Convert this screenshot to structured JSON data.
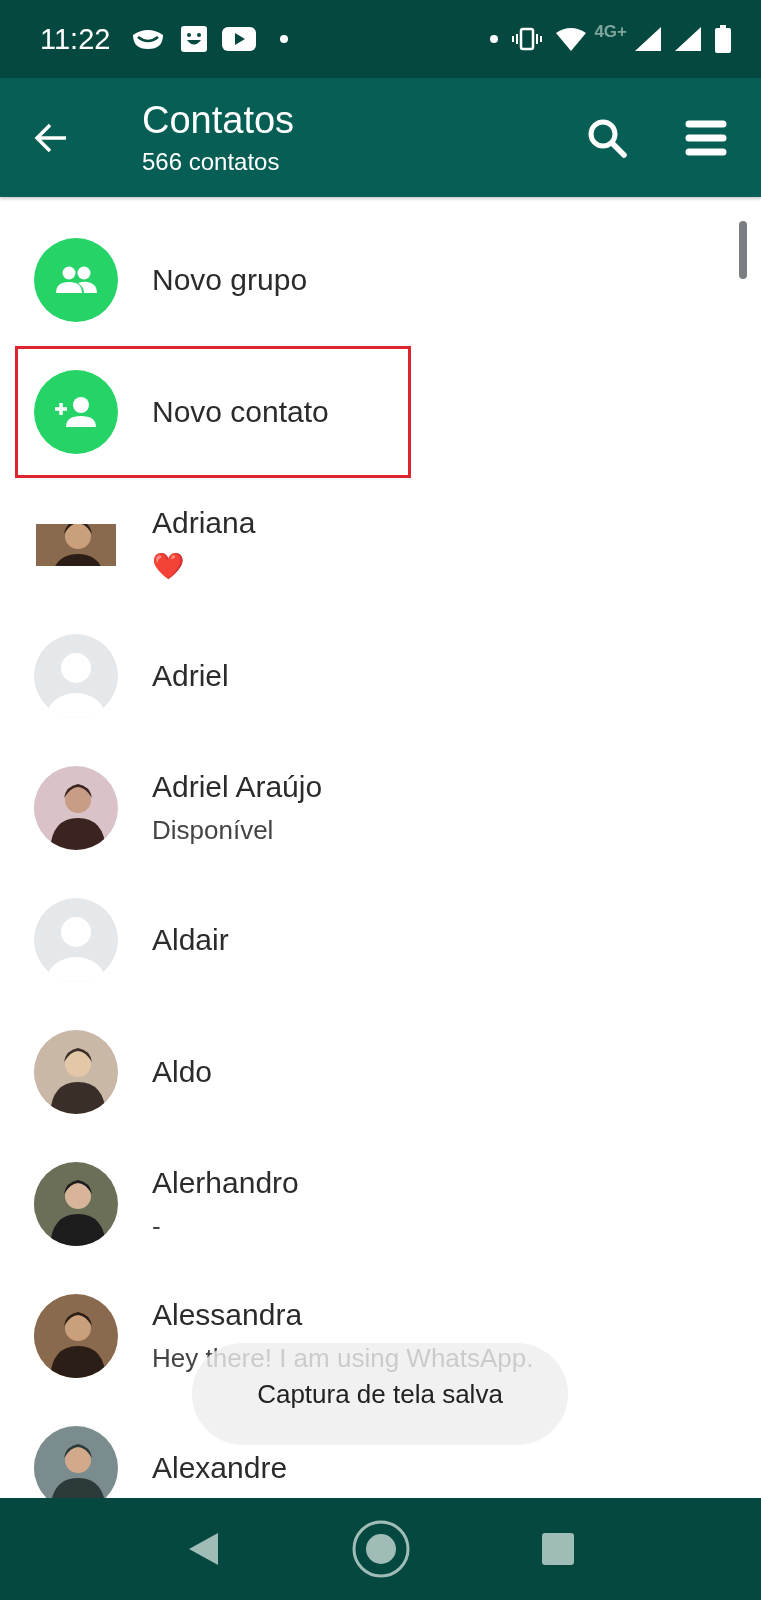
{
  "status_bar": {
    "time": "11:22",
    "network": "4G+"
  },
  "app_bar": {
    "title": "Contatos",
    "subtitle": "566 contatos"
  },
  "rows": [
    {
      "kind": "group",
      "name": "Novo grupo",
      "highlighted": false
    },
    {
      "kind": "addcontact",
      "name": "Novo contato",
      "highlighted": true
    },
    {
      "kind": "widephoto",
      "name": "Adriana",
      "status": "❤️",
      "highlighted": false
    },
    {
      "kind": "blank",
      "name": "Adriel",
      "highlighted": false
    },
    {
      "name": "Adriel Araújo",
      "status": "Disponível",
      "highlighted": false
    },
    {
      "kind": "blank",
      "name": "Aldair",
      "highlighted": false
    },
    {
      "name": "Aldo",
      "highlighted": false
    },
    {
      "name": "Alerhandro",
      "status": "-",
      "highlighted": false
    },
    {
      "name": "Alessandra",
      "status": "Hey there! I am using WhatsApp.",
      "highlighted": false
    },
    {
      "name": "Alexandre",
      "highlighted": false
    }
  ],
  "toast": "Captura de tela salva"
}
